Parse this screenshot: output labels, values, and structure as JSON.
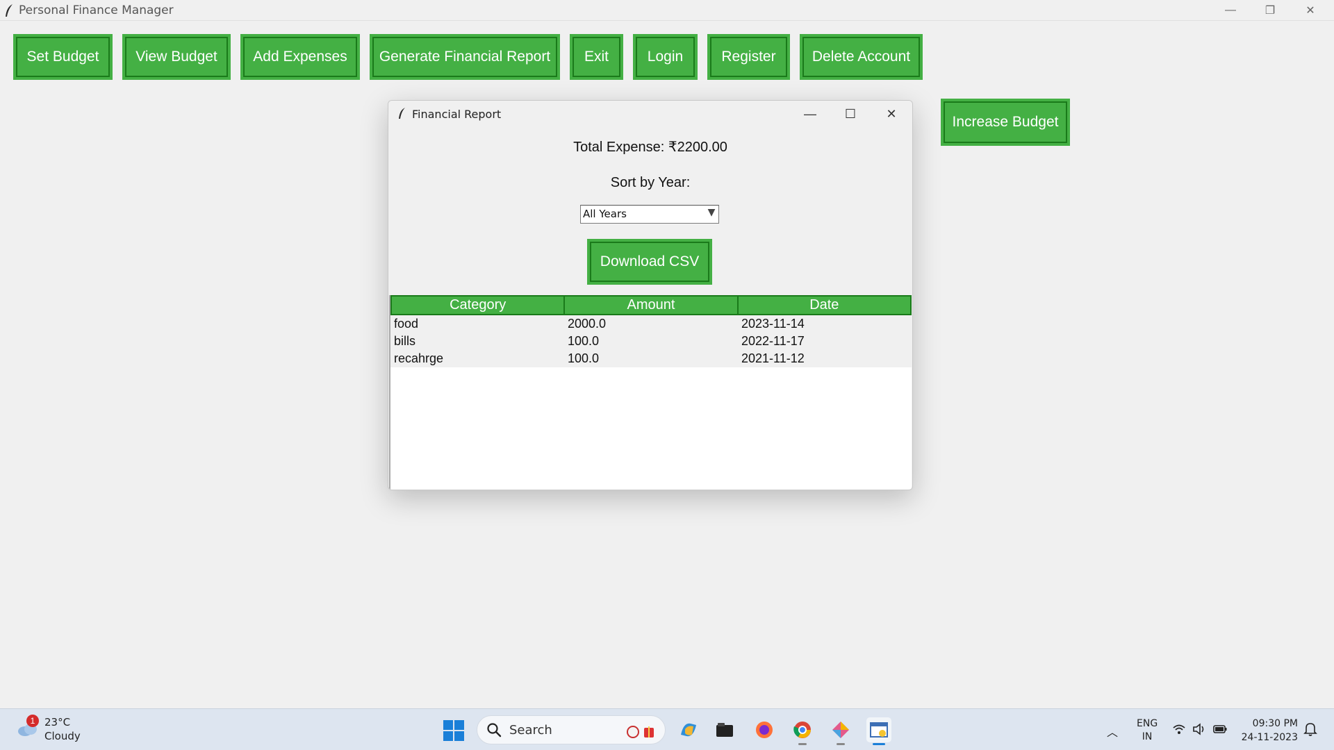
{
  "main_window": {
    "title": "Personal Finance Manager",
    "controls": {
      "minimize": "—",
      "restore": "❐",
      "close": "✕"
    }
  },
  "toolbar": {
    "buttons": [
      "Set Budget",
      "View Budget",
      "Add Expenses",
      "Generate Financial Report",
      "Exit",
      "Login",
      "Register",
      "Delete Account"
    ]
  },
  "side": {
    "increase_budget": "Increase Budget"
  },
  "dialog": {
    "title": "Financial Report",
    "controls": {
      "minimize": "—",
      "maximize": "☐",
      "close": "✕"
    },
    "total_expense": "Total Expense: ₹2200.00",
    "sort_label": "Sort by Year:",
    "year_select": {
      "selected": "All Years"
    },
    "download_button": "Download CSV",
    "table": {
      "columns": [
        "Category",
        "Amount",
        "Date"
      ],
      "rows": [
        [
          "food",
          "2000.0",
          "2023-11-14"
        ],
        [
          "bills",
          "100.0",
          "2022-11-17"
        ],
        [
          "recahrge",
          "100.0",
          "2021-11-12"
        ]
      ]
    }
  },
  "taskbar": {
    "weather": {
      "badge": "1",
      "temp": "23°C",
      "condition": "Cloudy"
    },
    "search_placeholder": "Search",
    "language": {
      "line1": "ENG",
      "line2": "IN"
    },
    "clock": {
      "time": "09:30 PM",
      "date": "24-11-2023"
    },
    "colors": {
      "button_green": "#44b044",
      "button_border": "#1a7a1a",
      "accent": "#1a7fd8"
    }
  }
}
